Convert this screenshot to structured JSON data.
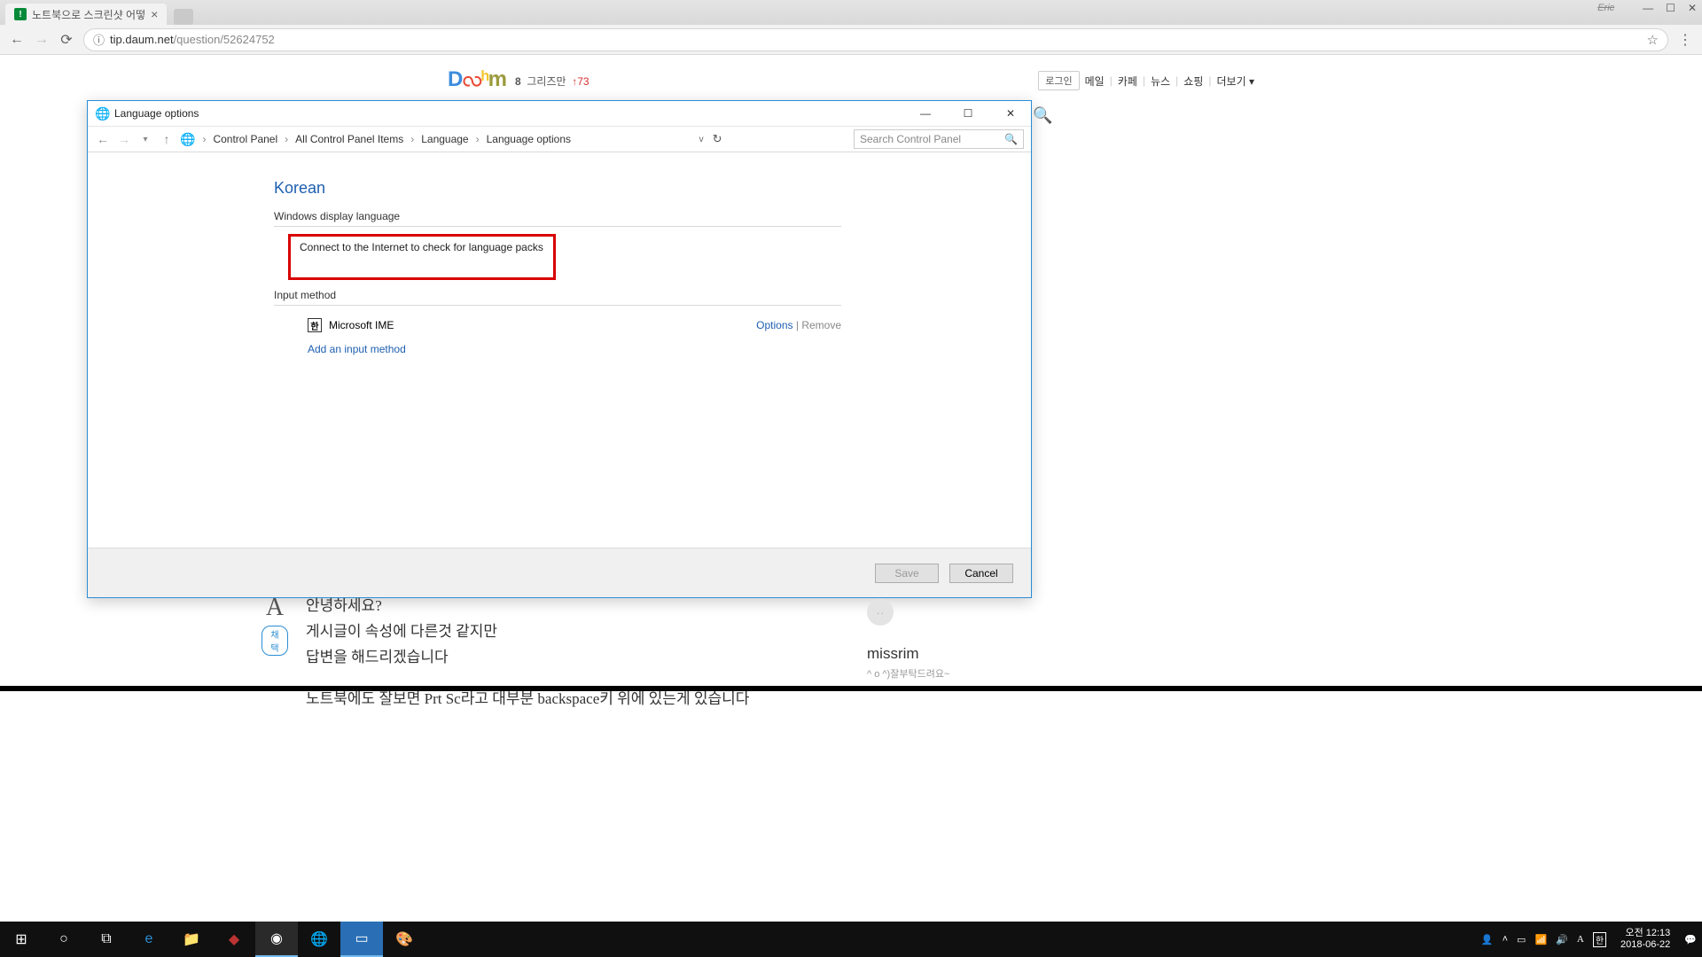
{
  "browser": {
    "tab_title": "노트북으로 스크린샷 어떻",
    "user": "Eric",
    "url_host": "tip.daum.net",
    "url_path": "/question/52624752"
  },
  "daum": {
    "meta_num": "8",
    "meta_name": "그리즈만",
    "meta_up": "↑73",
    "nav": {
      "login": "로그인",
      "mail": "메일",
      "cafe": "카페",
      "news": "뉴스",
      "shop": "쇼핑",
      "more": "더보기"
    }
  },
  "cp": {
    "title": "Language options",
    "crumbs": [
      "Control Panel",
      "All Control Panel Items",
      "Language",
      "Language options"
    ],
    "search_ph": "Search Control Panel",
    "lang_heading": "Korean",
    "display_section": "Windows display language",
    "connect_msg": "Connect to the Internet to check for language packs",
    "input_section": "Input method",
    "ime_label": "Microsoft IME",
    "ime_badge": "한",
    "options": "Options",
    "remove": "Remove",
    "add_input": "Add an input method",
    "save": "Save",
    "cancel": "Cancel"
  },
  "answer": {
    "tag": "채택",
    "l1": "안녕하세요?",
    "l2": "게시글이 속성에 다른것 같지만",
    "l3": "답변을 해드리겠습니다",
    "l4": "노트북에도 잘보면 Prt Sc라고 대부분 backspace키 위에 있는게 있습니다"
  },
  "side": {
    "name": "missrim",
    "sub": "^ o ^)잘부탁드려요~"
  },
  "taskbar": {
    "time": "오전 12:13",
    "date": "2018-06-22"
  }
}
